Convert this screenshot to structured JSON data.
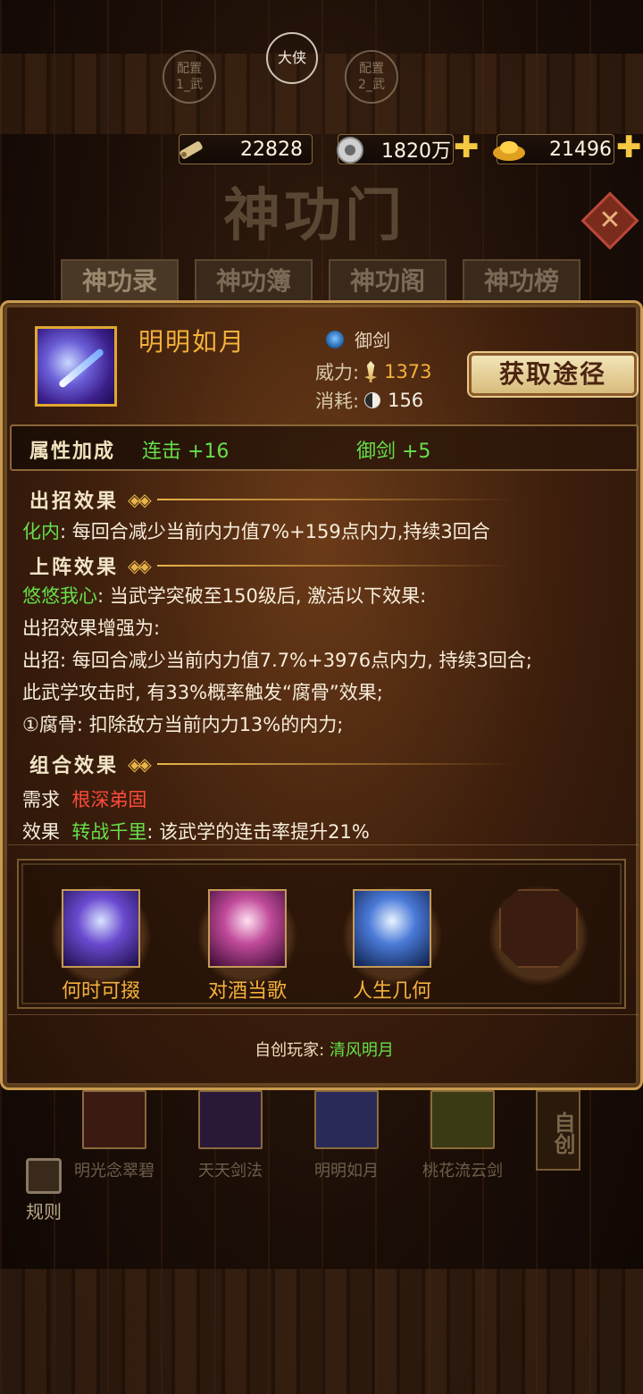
{
  "config": {
    "left_line1": "配置",
    "left_line2": "1_武",
    "center": "大侠",
    "right_line1": "配置",
    "right_line2": "2_武"
  },
  "currency": {
    "scroll": "22828",
    "silver": "1820万",
    "gold": "21496"
  },
  "background": {
    "title": "神功门",
    "tabs": [
      "神功录",
      "神功簿",
      "神功阁",
      "神功榜"
    ],
    "strip": [
      {
        "name": "明光念翠碧"
      },
      {
        "name": "天天剑法"
      },
      {
        "name": "明明如月"
      },
      {
        "name": "桃花流云剑"
      }
    ],
    "zichuang": "自创",
    "rule": "规则"
  },
  "panel": {
    "skill_name": "明明如月",
    "type": "御剑",
    "power_label": "威力:",
    "power_value": "1373",
    "cost_label": "消耗:",
    "cost_value": "156",
    "get_button": "获取途径",
    "attr": {
      "title": "属性加成",
      "items": [
        "连击 +16",
        "御剑 +5"
      ]
    },
    "chuzhao": {
      "heading": "出招效果",
      "name": "化内",
      "text": ": 每回合减少当前内力值7%+159点内力,持续3回合"
    },
    "shangzhen": {
      "heading": "上阵效果",
      "name": "悠悠我心",
      "text": ": 当武学突破至150级后, 激活以下效果:",
      "lines": [
        "出招效果增强为:",
        "出招: 每回合减少当前内力值7.7%+3976点内力, 持续3回合;",
        "此武学攻击时, 有33%概率触发“腐骨”效果;",
        "①腐骨: 扣除敌方当前内力13%的内力;"
      ]
    },
    "combo": {
      "heading": "组合效果",
      "req_label": "需求",
      "req_value": "根深弟固",
      "effect_label": "效果",
      "effect_name": "转战千里",
      "effect_text": ": 该武学的连击率提升21%",
      "members": [
        "何时可掇",
        "对酒当歌",
        "人生几何"
      ]
    },
    "creator_label": "自创玩家: ",
    "creator_name": "清风明月"
  },
  "colors": {
    "gold_text": "#f4b13b",
    "green_text": "#66e04a",
    "red_text": "#ff4a3a",
    "panel_border": "#c99a4f"
  }
}
